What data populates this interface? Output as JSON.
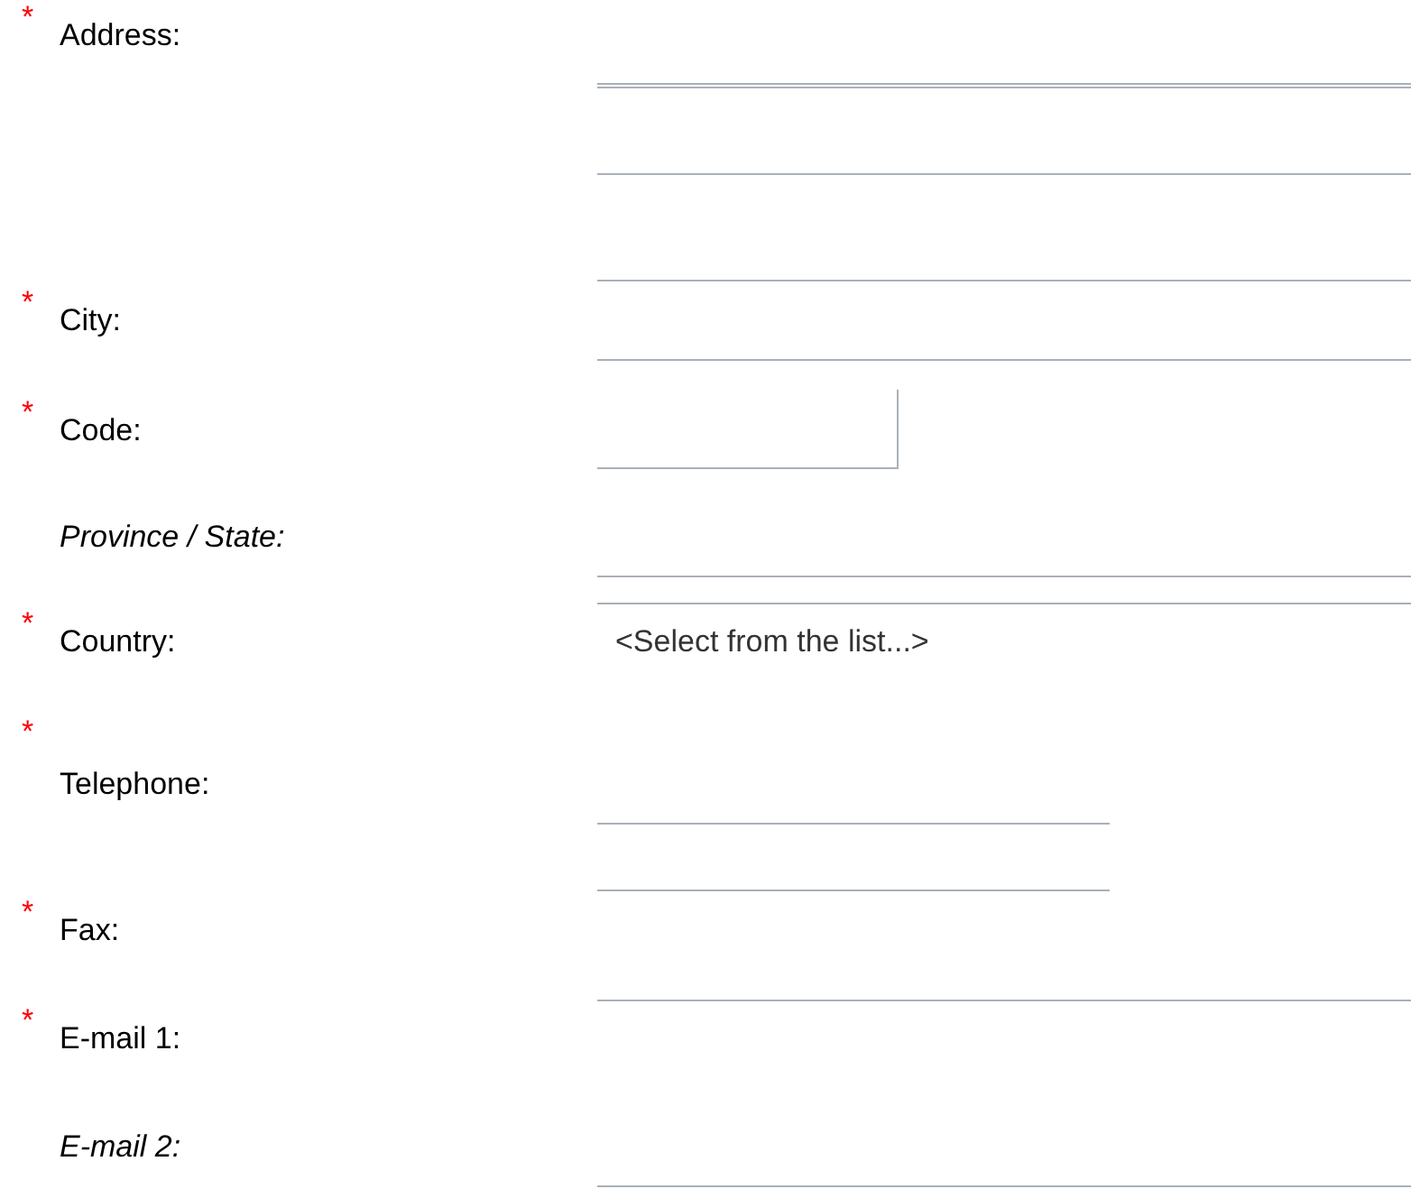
{
  "fields": [
    {
      "label": "Address:",
      "marker": "*",
      "required": true,
      "kind": "inline",
      "input": {
        "kind": "textarea"
      }
    },
    {
      "label": "City:",
      "marker": "*",
      "required": true,
      "kind": "inline",
      "input": {
        "kind": "text"
      }
    },
    {
      "label": "Code:",
      "marker": "*",
      "required": true,
      "kind": "inline",
      "input": {
        "kind": "text"
      }
    },
    {
      "label": "Province / State:",
      "required": false,
      "kind": "inline",
      "input": {
        "kind": "text"
      }
    },
    {
      "label": "Country:",
      "marker": "*",
      "required": true,
      "kind": "inline",
      "input": {
        "kind": "select",
        "placeholder": "<Select from the list...>"
      }
    },
    {
      "label": "Telephone:",
      "marker": "*",
      "required": true,
      "kind": "stacked",
      "input": {
        "kind": "text"
      }
    },
    {
      "label": "Fax:",
      "marker": "*",
      "required": true,
      "kind": "inline",
      "input": {
        "kind": "text"
      }
    },
    {
      "label": "E-mail 1:",
      "marker": "*",
      "required": true,
      "kind": "inline",
      "input": {
        "kind": "text"
      }
    },
    {
      "label": "E-mail 2:",
      "required": false,
      "kind": "inline",
      "input": {
        "kind": "text"
      }
    }
  ]
}
